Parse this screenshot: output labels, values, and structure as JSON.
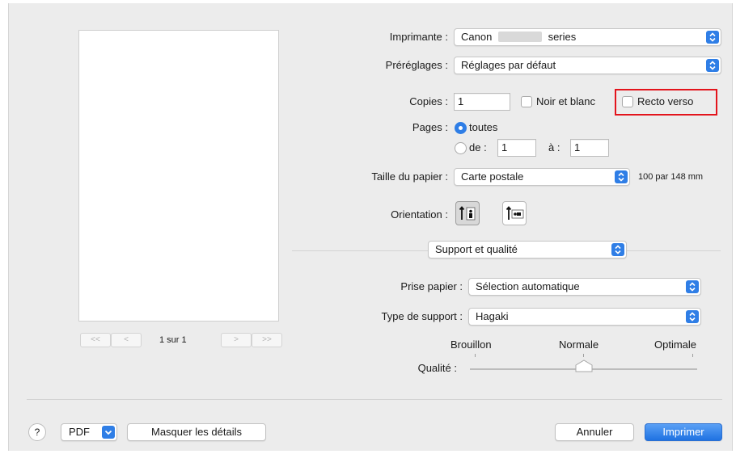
{
  "printer": {
    "label": "Imprimante :",
    "value_prefix": "Canon",
    "value_suffix": "series"
  },
  "presets": {
    "label": "Préréglages :",
    "value": "Réglages par défaut"
  },
  "copies": {
    "label": "Copies :",
    "value": "1"
  },
  "bw": {
    "label": "Noir et blanc",
    "checked": false
  },
  "duplex": {
    "label": "Recto verso",
    "checked": false,
    "highlight_color": "#e3141c"
  },
  "pages": {
    "label": "Pages :",
    "all_label": "toutes",
    "range_label": "de :",
    "from": "1",
    "to_label": "à :",
    "to": "1",
    "selected": "toutes"
  },
  "paper_size": {
    "label": "Taille du papier :",
    "value": "Carte postale",
    "dimensions": "100 par 148 mm"
  },
  "orientation": {
    "label": "Orientation :",
    "selected": "portrait"
  },
  "section": {
    "value": "Support et qualité"
  },
  "paper_source": {
    "label": "Prise papier :",
    "value": "Sélection automatique"
  },
  "media_type": {
    "label": "Type de support :",
    "value": "Hagaki"
  },
  "quality": {
    "label": "Qualité :",
    "levels": [
      "Brouillon",
      "Normale",
      "Optimale"
    ],
    "selected": "Normale"
  },
  "preview_nav": {
    "first": "<<",
    "prev": "<",
    "page": "1 sur 1",
    "next": ">",
    "last": ">>"
  },
  "footer": {
    "help": "?",
    "pdf": "PDF",
    "hide_details": "Masquer les détails",
    "cancel": "Annuler",
    "print": "Imprimer"
  },
  "colors": {
    "accent": "#2f7ee6",
    "dialog_bg": "#ececec"
  }
}
